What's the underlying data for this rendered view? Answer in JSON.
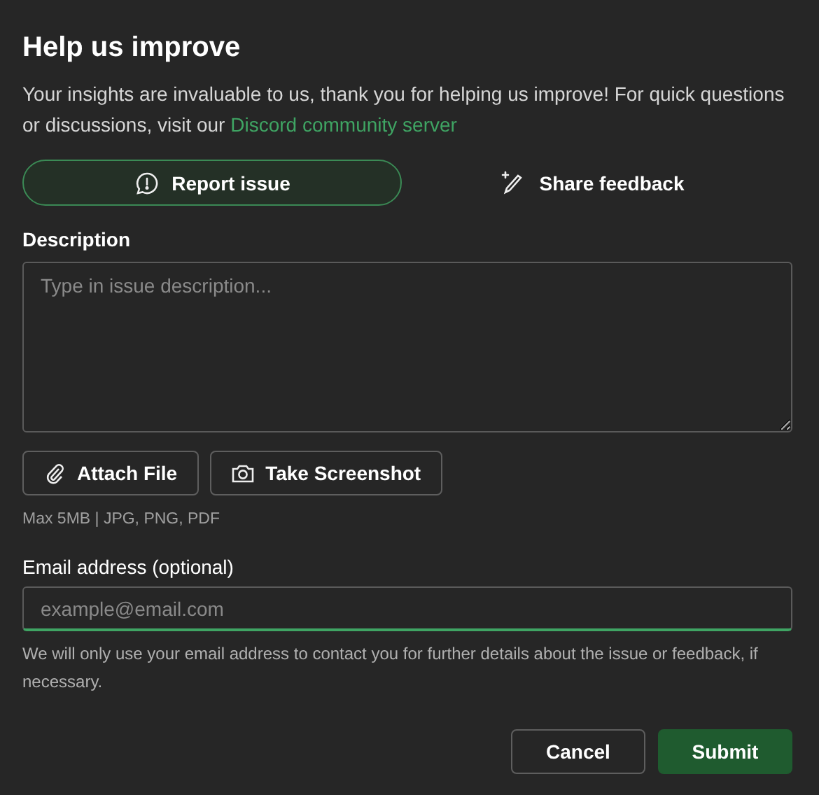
{
  "title": "Help us improve",
  "intro": {
    "text": "Your insights are invaluable to us, thank you for helping us improve! For quick questions or discussions, visit our ",
    "link": "Discord community server"
  },
  "tabs": [
    {
      "label": "Report issue",
      "selected": true
    },
    {
      "label": "Share feedback",
      "selected": false
    }
  ],
  "description": {
    "label": "Description",
    "placeholder": "Type in issue description..."
  },
  "attach_buttons": [
    "Attach File",
    "Take Screenshot"
  ],
  "attach_hint": "Max 5MB | JPG, PNG, PDF",
  "email": {
    "label": "Email address (optional)",
    "placeholder": "example@email.com",
    "focused": true,
    "help": "We will only use your email address to contact you for further details about the issue or feedback, if necessary."
  },
  "buttons": [
    {
      "label": "Cancel",
      "kind": "secondary"
    },
    {
      "label": "Submit",
      "kind": "primary"
    }
  ]
}
